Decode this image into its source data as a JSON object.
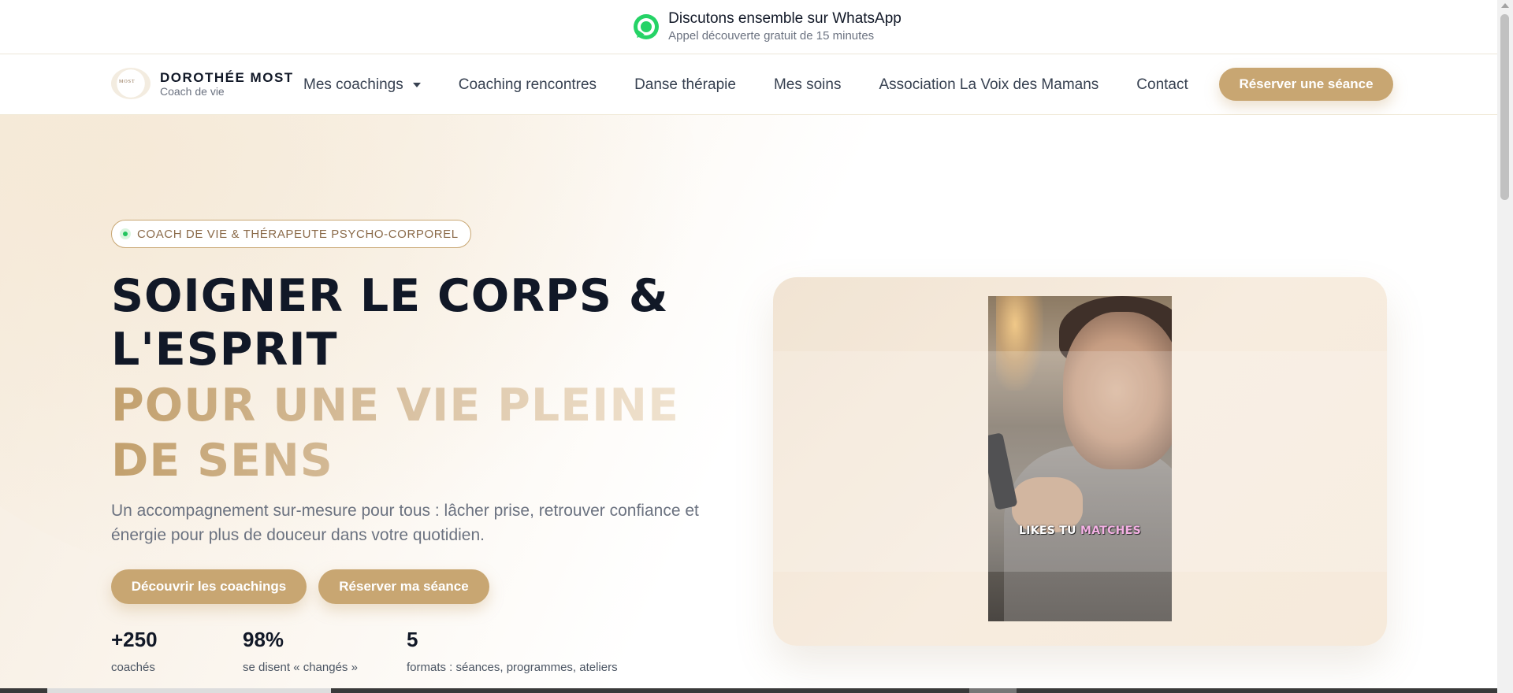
{
  "topbar": {
    "title": "Discutons ensemble sur WhatsApp",
    "subtitle": "Appel découverte gratuit de 15 minutes",
    "icon": "whatsapp-icon"
  },
  "brand": {
    "name": "DOROTHÉE MOST",
    "tagline": "Coach de vie",
    "logo_text": "MOST"
  },
  "nav": {
    "items": [
      {
        "label": "Mes coachings",
        "has_dropdown": true
      },
      {
        "label": "Coaching rencontres"
      },
      {
        "label": "Danse thérapie"
      },
      {
        "label": "Mes soins"
      },
      {
        "label": "Association La Voix des Mamans"
      },
      {
        "label": "Contact"
      }
    ],
    "cta": "Réserver une séance"
  },
  "hero": {
    "badge": "COACH DE VIE & THÉRAPEUTE PSYCHO-CORPOREL",
    "title_line1": "SOIGNER LE CORPS &",
    "title_line2": "L'ESPRIT",
    "title_gold": "POUR UNE VIE PLEINE DE SENS",
    "lead": "Un accompagnement sur-mesure pour tous : lâcher prise, retrouver confiance et énergie pour plus de douceur dans votre quotidien.",
    "btn_primary": "Découvrir les coachings",
    "btn_secondary": "Réserver ma séance",
    "stats": [
      {
        "value": "+250",
        "label": "coachés"
      },
      {
        "value": "98%",
        "label": "se disent « changés »"
      },
      {
        "value": "5",
        "label": "formats : séances, programmes, ateliers"
      }
    ]
  },
  "video": {
    "caption_white": "LIKES TU",
    "caption_accent": "MATCHES"
  },
  "colors": {
    "accent": "#c8a672",
    "text_dark": "#111827",
    "whatsapp": "#25d366"
  }
}
